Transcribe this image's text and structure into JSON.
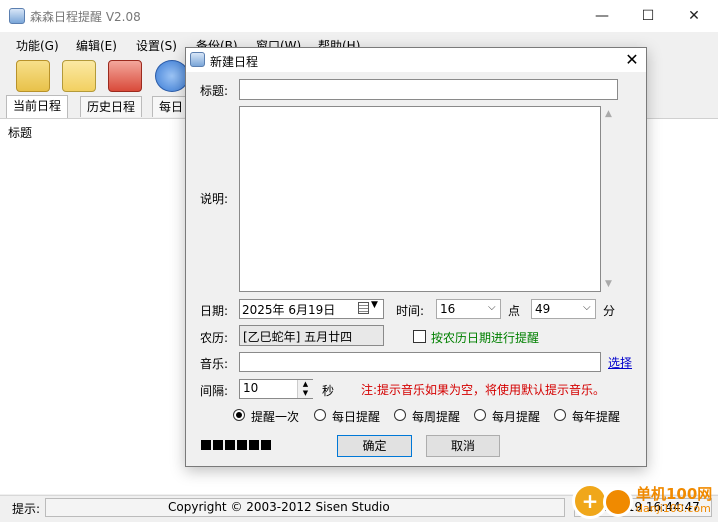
{
  "window": {
    "title": "森森日程提醒 V2.08",
    "controls": {
      "minimize": "—",
      "maximize": "☐",
      "close": "✕"
    }
  },
  "menu": [
    "功能(G)",
    "编辑(E)",
    "设置(S)",
    "备份(B)",
    "窗口(W)",
    "帮助(H)"
  ],
  "toolbar": {
    "icons": [
      "open-folder-icon",
      "edit-note-icon",
      "delete-icon",
      "check-icon"
    ],
    "colors": {
      "folder": "#e8c24a",
      "edit": "#f2d061",
      "delete": "#d94a3a",
      "check": "#3a7bd5"
    }
  },
  "tabs": [
    "当前日程",
    "历史日程",
    "每日"
  ],
  "list": {
    "column_title": "标题"
  },
  "status": {
    "hint_label": "提示:",
    "copyright": "Copyright © 2003-2012 Sisen Studio",
    "time": "2025-6-19 16:44:47"
  },
  "watermark": {
    "line1": "单机100网",
    "line2": "danji100.com"
  },
  "dialog": {
    "title": "新建日程",
    "close": "✕",
    "title_label": "标题:",
    "title_value": "",
    "desc_label": "说明:",
    "desc_value": "",
    "date_label": "日期:",
    "date_value": "2025年  6月19日",
    "time_label": "时间:",
    "hour": "16",
    "point_label": "点",
    "minute": "49",
    "minute_label": "分",
    "lunar_label": "农历:",
    "lunar_value": "[乙巳蛇年] 五月廿四",
    "lunar_checkbox_label": "按农历日期进行提醒",
    "lunar_checked": false,
    "music_label": "音乐:",
    "music_value": "",
    "browse_label": "选择",
    "interval_label": "间隔:",
    "interval_value": "10",
    "interval_unit": "秒",
    "note": "注:提示音乐如果为空，将使用默认提示音乐。",
    "repeat_options": [
      "提醒一次",
      "每日提醒",
      "每周提醒",
      "每月提醒",
      "每年提醒"
    ],
    "repeat_selected": "提醒一次",
    "progress_blocks": 6,
    "ok_label": "确定",
    "cancel_label": "取消"
  }
}
